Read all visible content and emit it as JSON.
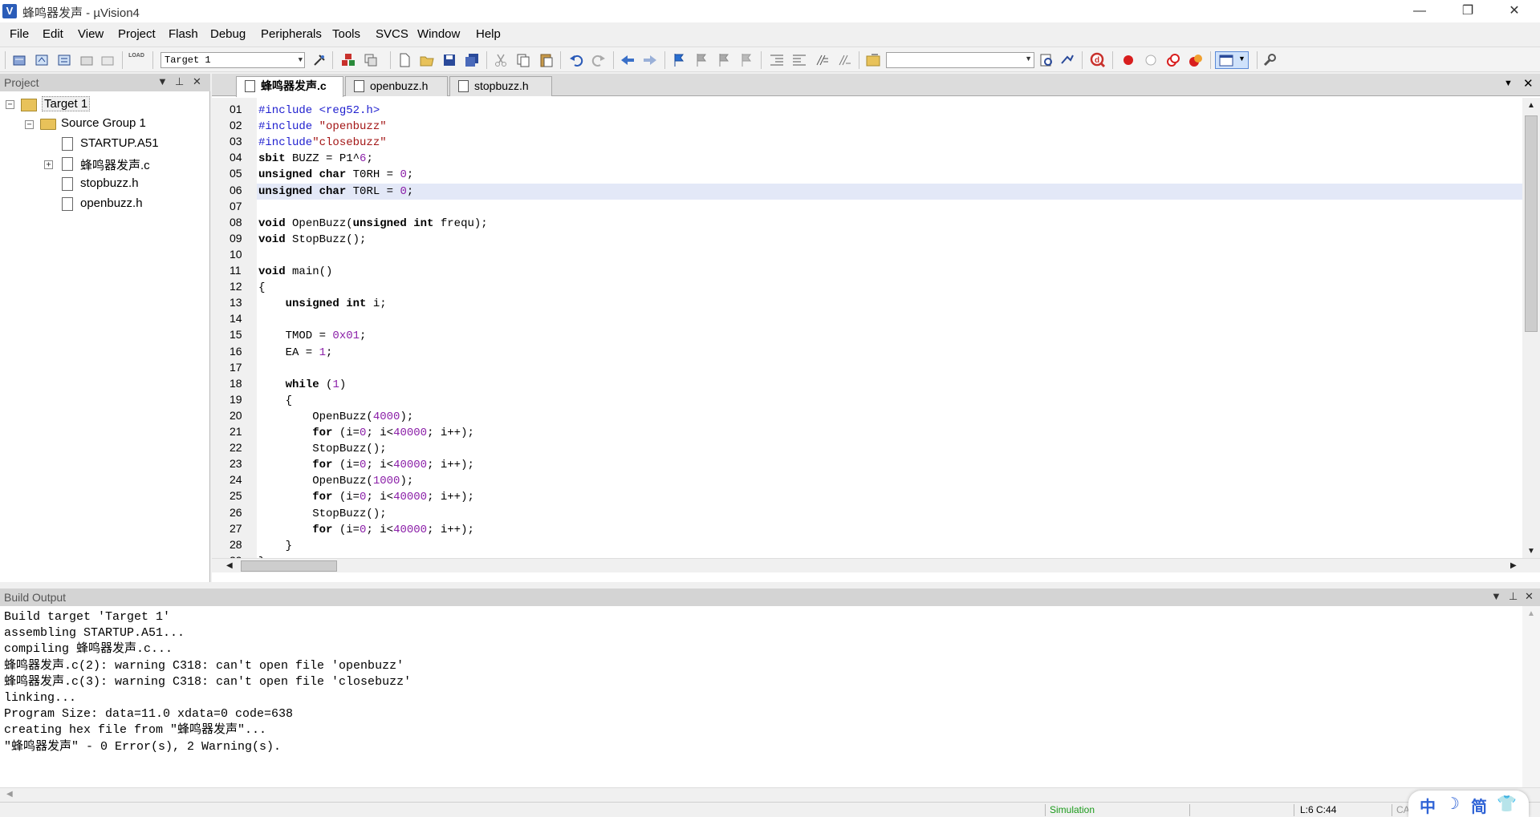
{
  "window": {
    "title": "蜂鸣器发声 - µVision4",
    "app_icon": "V",
    "min": "—",
    "max": "❐",
    "close": "✕"
  },
  "menu": [
    "File",
    "Edit",
    "View",
    "Project",
    "Flash",
    "Debug",
    "Peripherals",
    "Tools",
    "SVCS",
    "Window",
    "Help"
  ],
  "toolbar": {
    "target": "Target 1",
    "find": "",
    "load_label": "LOAD"
  },
  "project": {
    "title": "Project",
    "target": "Target 1",
    "group": "Source Group 1",
    "files": [
      "STARTUP.A51",
      "蜂鸣器发声.c",
      "stopbuzz.h",
      "openbuzz.h"
    ]
  },
  "editor": {
    "tabs": [
      "蜂鸣器发声.c",
      "openbuzz.h",
      "stopbuzz.h"
    ],
    "active_tab": 0,
    "highlight_line": 6,
    "lines": [
      "#include <reg52.h>",
      "#include \"openbuzz\"",
      "#include\"closebuzz\"",
      "sbit BUZZ = P1^6;",
      "unsigned char T0RH = 0;",
      "unsigned char T0RL = 0;",
      "",
      "void OpenBuzz(unsigned int frequ);",
      "void StopBuzz();",
      "",
      "void main()",
      "{",
      "    unsigned int i;",
      "",
      "    TMOD = 0x01;",
      "    EA = 1;",
      "",
      "    while (1)",
      "    {",
      "        OpenBuzz(4000);",
      "        for (i=0; i<40000; i++);",
      "        StopBuzz();",
      "        for (i=0; i<40000; i++);",
      "        OpenBuzz(1000);",
      "        for (i=0; i<40000; i++);",
      "        StopBuzz();",
      "        for (i=0; i<40000; i++);",
      "    }",
      "}"
    ]
  },
  "output": {
    "title": "Build Output",
    "lines": [
      "Build target 'Target 1'",
      "assembling STARTUP.A51...",
      "compiling 蜂鸣器发声.c...",
      "蜂鸣器发声.c(2): warning C318: can't open file 'openbuzz'",
      "蜂鸣器发声.c(3): warning C318: can't open file 'closebuzz'",
      "linking...",
      "Program Size: data=11.0 xdata=0 code=638",
      "creating hex file from \"蜂鸣器发声\"...",
      "\"蜂鸣器发声\" - 0 Error(s), 2 Warning(s)."
    ]
  },
  "status": {
    "mode": "Simulation",
    "position": "L:6 C:44",
    "caps": "CAP"
  },
  "ime": [
    "中",
    "☽",
    "简",
    "👕"
  ],
  "colors": {
    "accent": "#2f63d6",
    "highlight": "#e3e8f7",
    "keyword": "#000000",
    "string": "#a31515",
    "number": "#8b1fa8"
  }
}
